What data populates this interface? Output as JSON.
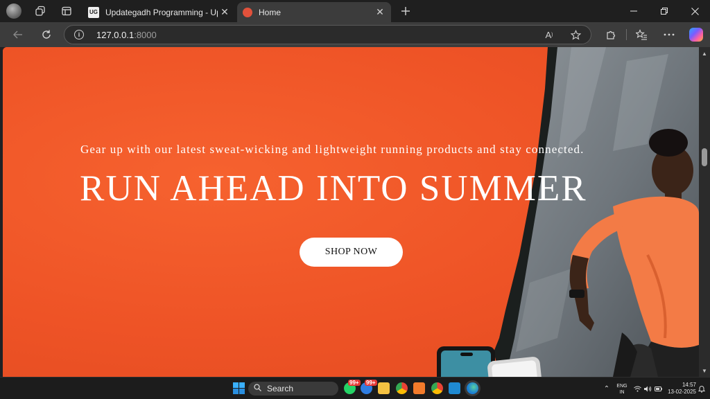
{
  "browser": {
    "tabs": [
      {
        "title": "Updategadh Programming - Upda",
        "favicon_label": "UG",
        "active": false
      },
      {
        "title": "Home",
        "active": true
      }
    ],
    "url_host": "127.0.0.1",
    "url_port": ":8000",
    "icons": {
      "workspaces": "workspaces-icon",
      "tab_actions": "tab-actions-icon",
      "new_tab": "plus-icon",
      "back": "back-arrow-icon",
      "reload": "reload-icon",
      "site_info": "info-icon",
      "read_aloud": "read-aloud-icon",
      "favorite": "star-icon",
      "extensions": "puzzle-icon",
      "favorites": "favorites-icon",
      "more": "more-icon",
      "copilot": "copilot-icon"
    }
  },
  "hero": {
    "subtitle": "Gear up with our latest sweat-wicking and lightweight running products and stay connected.",
    "headline": "RUN AHEAD INTO SUMMER",
    "cta_label": "SHOP NOW",
    "background_color": "#f05a2c"
  },
  "taskbar": {
    "search_label": "Search",
    "badges": [
      "99+",
      "99+"
    ],
    "language_line1": "ENG",
    "language_line2": "IN",
    "time": "14:57",
    "date": "13-02-2025"
  }
}
